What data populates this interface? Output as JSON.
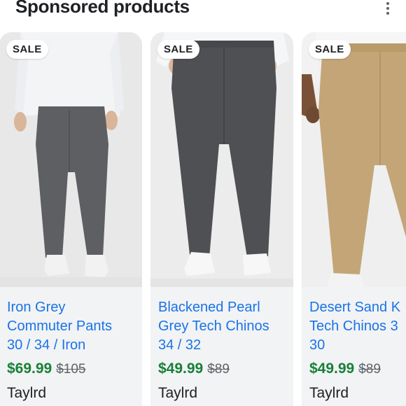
{
  "header": {
    "title": "Sponsored products"
  },
  "products": [
    {
      "badge": "SALE",
      "title_lines": [
        "Iron Grey",
        "Commuter Pants",
        "30 / 34 / Iron"
      ],
      "price": "$69.99",
      "old_price": "$105",
      "merchant": "Taylrd",
      "pant_color": "#5e5f62"
    },
    {
      "badge": "SALE",
      "title_lines": [
        "Blackened Pearl",
        "Grey Tech Chinos",
        "34 / 32"
      ],
      "price": "$49.99",
      "old_price": "$89",
      "merchant": "Taylrd",
      "pant_color": "#4f5053"
    },
    {
      "badge": "SALE",
      "title_lines": [
        "Desert Sand K",
        "Tech Chinos 3",
        "30"
      ],
      "price": "$49.99",
      "old_price": "$89",
      "merchant": "Taylrd",
      "pant_color": "#c4a577"
    }
  ],
  "colors": {
    "title_link": "#1a73e8",
    "price": "#188038",
    "card_body_bg": "#f1f3f4"
  },
  "icons": {
    "more": "more-vert-icon"
  }
}
